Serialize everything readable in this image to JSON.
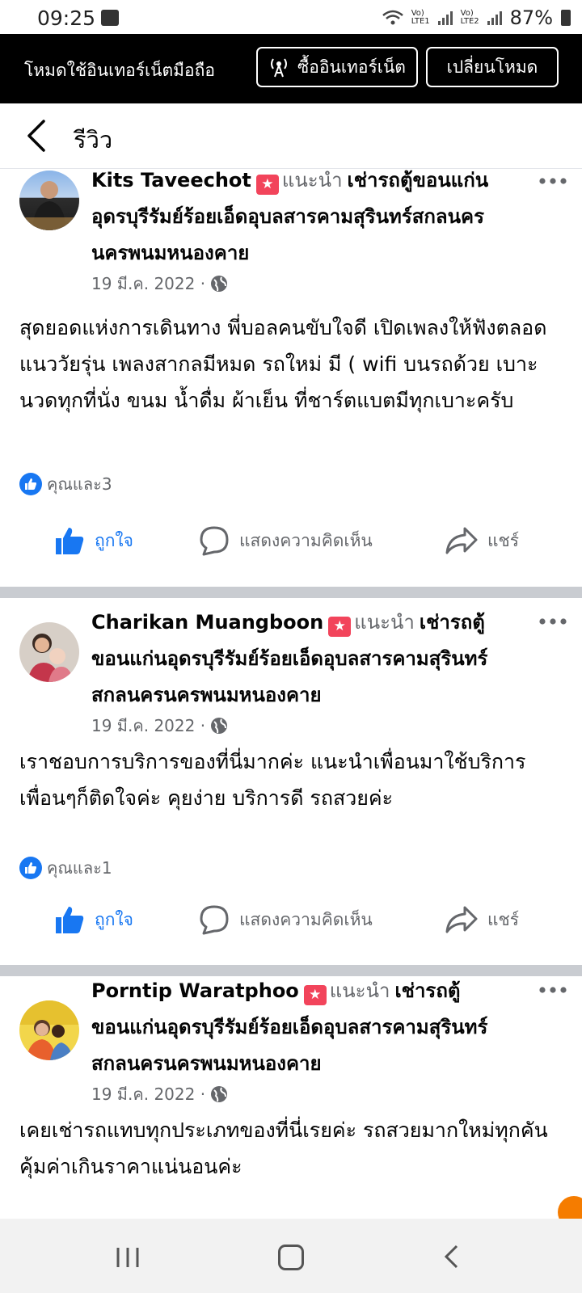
{
  "status_bar": {
    "time": "09:25",
    "network1": "Vo)\nLTE1",
    "network2": "Vo)\nLTE2",
    "battery": "87%"
  },
  "mode_bar": {
    "text": "โหมดใช้อินเทอร์เน็ตมือถือ",
    "buy_label": "ซื้ออินเทอร์เน็ต",
    "switch_label": "เปลี่ยนโหมด"
  },
  "header": {
    "title": "รีวิว"
  },
  "reviews": [
    {
      "author": "Kits Taveechot",
      "recommend": "แนะนำ",
      "page": "เช่ารถตู้ขอนแก่นอุดรบุรีรัมย์ร้อยเอ็ดอุบลสารคามสุรินทร์สกลนครนครพนมหนองคาย",
      "date": "19 มี.ค. 2022 ·",
      "text": "สุดยอดแห่งการเดินทาง พี่บอลคนขับใจดี เปิดเพลงให้ฟังตลอด แนววัยรุ่น เพลงสากลมีหมด รถใหม่ มี ( wifi บนรถด้วย เบาะนวดทุกที่นั่ง ขนม น้ำดื่ม ผ้าเย็น ที่ชาร์ตแบตมีทุกเบาะครับ",
      "reactions": "คุณและ3"
    },
    {
      "author": "Charikan Muangboon",
      "recommend": "แนะนำ",
      "page": "เช่ารถตู้ ขอนแก่นอุดรบุรีรัมย์ร้อยเอ็ดอุบลสารคามสุรินทร์สกลนครนครพนมหนองคาย",
      "date": "19 มี.ค. 2022 ·",
      "text": "เราชอบการบริการของที่นี่มากค่ะ แนะนำเพื่อนมาใช้บริการเพื่อนๆก็ติดใจค่ะ คุยง่าย บริการดี รถสวยค่ะ",
      "reactions": "คุณและ1"
    },
    {
      "author": "Porntip Waratphoo",
      "recommend": "แนะนำ",
      "page": "เช่ารถตู้ขอนแก่นอุดรบุรีรัมย์ร้อยเอ็ดอุบลสารคามสุรินทร์สกลนครนครพนมหนองคาย",
      "date": "19 มี.ค. 2022 ·",
      "text": "เคยเช่ารถแทบทุกประเภทของที่นี่เรยค่ะ รถสวยมากใหม่ทุกคัน คุ้มค่าเกินราคาแน่นอนค่ะ",
      "reactions": ""
    }
  ],
  "actions": {
    "like": "ถูกใจ",
    "comment": "แสดงความคิดเห็น",
    "share": "แชร์"
  },
  "colors": {
    "accent": "#1877f2",
    "recommend": "#f2445b",
    "secondary_text": "#65676b",
    "divider": "#c9ccd1"
  },
  "icons": [
    "antenna-icon",
    "back-icon",
    "recommend-icon",
    "globe-icon",
    "more-icon",
    "like-badge-icon",
    "thumbs-up-icon",
    "comment-icon",
    "share-icon",
    "nav-recents-icon",
    "nav-home-icon",
    "nav-back-icon"
  ]
}
